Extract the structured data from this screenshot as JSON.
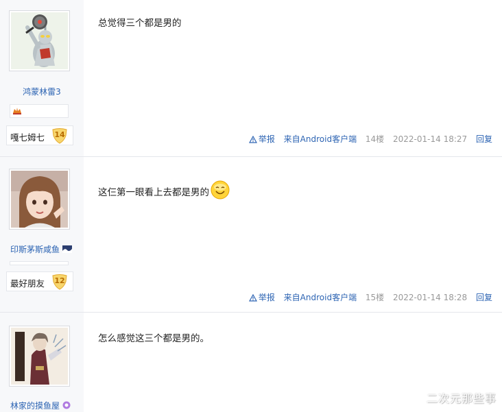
{
  "posts": [
    {
      "username": "鸿蒙林雷3",
      "level_name": "嘎七姆七",
      "level_num": "14",
      "content": "总觉得三个都是男的",
      "report": "举报",
      "source": "来自Android客户端",
      "floor": "14楼",
      "time": "2022-01-14 18:27",
      "reply": "回复"
    },
    {
      "username": "印斯茅斯咸鱼",
      "level_name": "最好朋友",
      "level_num": "12",
      "content": "这仨第一眼看上去都是男的",
      "report": "举报",
      "source": "来自Android客户端",
      "floor": "15楼",
      "time": "2022-01-14 18:28",
      "reply": "回复"
    },
    {
      "username": "林家的摸鱼屋",
      "content": "怎么感觉这三个都是男的。"
    }
  ],
  "watermark": "二次元那些事",
  "colors": {
    "link": "#2d64b3",
    "meta": "#999999",
    "sidebar_bg": "#f7f8fa"
  }
}
